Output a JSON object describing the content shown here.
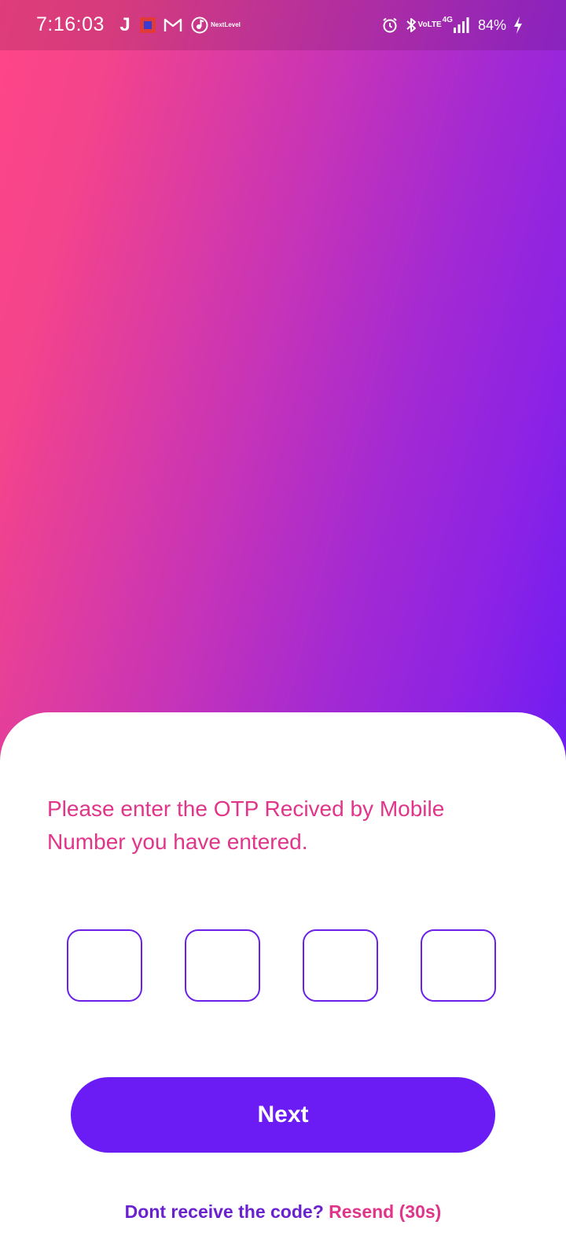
{
  "status_bar": {
    "time": "7:16:03",
    "left_icons": [
      "jio-icon",
      "app-square-icon",
      "gmail-icon",
      "music-icon",
      "next-level-icon"
    ],
    "next_level_label_line1": "Next",
    "next_level_label_line2": "Level",
    "volte_line1": "Vo",
    "volte_line2": "LTE",
    "network": "4G",
    "battery_percent": "84%",
    "right_icons": [
      "alarm-icon",
      "bluetooth-icon",
      "volte-icon",
      "signal-icon",
      "battery-charging-icon"
    ]
  },
  "background": {
    "gradient_start": "#ff4587",
    "gradient_end": "#6d1cf4"
  },
  "otp": {
    "instruction": "Please enter the OTP Recived by Mobile Number you have entered.",
    "fields": [
      "",
      "",
      "",
      ""
    ],
    "border_color": "#6b1fe8"
  },
  "next_button": {
    "label": "Next",
    "color": "#6b1cf4"
  },
  "resend": {
    "prompt": "Dont receive the code?",
    "link": "Resend (30s)",
    "prompt_color": "#6a22cf",
    "link_color": "#e0358a"
  }
}
